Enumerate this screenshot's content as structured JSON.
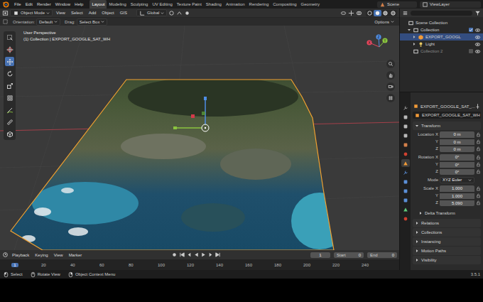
{
  "app": {
    "version": "3.5.1"
  },
  "menu": [
    "File",
    "Edit",
    "Render",
    "Window",
    "Help"
  ],
  "workspaces": [
    {
      "label": "Layout",
      "selected": true
    },
    {
      "label": "Modeling",
      "selected": false
    },
    {
      "label": "Sculpting",
      "selected": false
    },
    {
      "label": "UV Editing",
      "selected": false
    },
    {
      "label": "Texture Paint",
      "selected": false
    },
    {
      "label": "Shading",
      "selected": false
    },
    {
      "label": "Animation",
      "selected": false
    },
    {
      "label": "Rendering",
      "selected": false
    },
    {
      "label": "Compositing",
      "selected": false
    },
    {
      "label": "Geometry",
      "selected": false
    }
  ],
  "scene": {
    "name": "Scene"
  },
  "view_layer": {
    "name": "ViewLayer"
  },
  "viewport_header": {
    "mode": "Object Mode",
    "menus": [
      "View",
      "Select",
      "Add",
      "Object",
      "GIS"
    ],
    "orientation": "Global",
    "shading": [
      {
        "kind": "wireframe",
        "selected": false
      },
      {
        "kind": "solid",
        "selected": true
      },
      {
        "kind": "material",
        "selected": false
      },
      {
        "kind": "rendered",
        "selected": false
      }
    ]
  },
  "tool_header": {
    "orientation_label": "Orientation:",
    "orientation": "Default",
    "drag_label": "Drag:",
    "drag": "Select Box",
    "options": "Options"
  },
  "viewport": {
    "view_name": "User Perspective",
    "context": "(1) Collection | EXPORT_GOOGLE_SAT_WH",
    "terrain": {
      "selected": true
    }
  },
  "tools": [
    {
      "kind": "select",
      "selected": false
    },
    {
      "kind": "cursor",
      "selected": false
    },
    {
      "kind": "move",
      "selected": true
    },
    {
      "kind": "rotate",
      "selected": false
    },
    {
      "kind": "scale",
      "selected": false
    },
    {
      "kind": "transform",
      "selected": false
    },
    {
      "kind": "annotate",
      "selected": false
    },
    {
      "kind": "measure",
      "selected": false
    },
    {
      "kind": "add-cube",
      "selected": false
    }
  ],
  "navigation": {
    "axes": [
      {
        "label": "X",
        "color": "#e8475f"
      },
      {
        "label": "Y",
        "color": "#8bc53f"
      },
      {
        "label": "Z",
        "color": "#4f8ee6"
      }
    ],
    "buttons": [
      {
        "kind": "zoom"
      },
      {
        "kind": "pan"
      },
      {
        "kind": "camera"
      },
      {
        "kind": "ortho"
      }
    ]
  },
  "outliner": {
    "items": [
      {
        "label": "Scene Collection",
        "kind": "scene_collection",
        "selected": false,
        "children": [
          {
            "label": "Collection",
            "kind": "collection",
            "selected": false,
            "expanded": true,
            "checked": true,
            "visible": true,
            "children": [
              {
                "label": "EXPORT_GOOGL",
                "kind": "mesh",
                "selected": true,
                "expanded": false,
                "visible": true
              },
              {
                "label": "Light",
                "kind": "light",
                "selected": false,
                "expanded": false,
                "visible": true
              }
            ]
          },
          {
            "label": "Collection 2",
            "kind": "collection",
            "selected": false,
            "checked": false,
            "visible": true
          }
        ]
      }
    ]
  },
  "property_tabs": [
    {
      "kind": "tool",
      "selected": false,
      "color": "#a0a0a0"
    },
    {
      "kind": "render",
      "selected": false,
      "color": "#b9b9b9"
    },
    {
      "kind": "output",
      "selected": false,
      "color": "#b9b9b9"
    },
    {
      "kind": "view_layer",
      "selected": false,
      "color": "#b9b9b9"
    },
    {
      "kind": "scene",
      "selected": false,
      "color": "#d27f4a"
    },
    {
      "kind": "world",
      "selected": false,
      "color": "#d0412f"
    },
    {
      "kind": "object",
      "selected": true,
      "color": "#f29b38"
    },
    {
      "kind": "modifier",
      "selected": false,
      "color": "#5b8fd8"
    },
    {
      "kind": "particles",
      "selected": false,
      "color": "#5b8fd8"
    },
    {
      "kind": "physics",
      "selected": false,
      "color": "#5b8fd8"
    },
    {
      "kind": "constraint",
      "selected": false,
      "color": "#5b8fd8"
    },
    {
      "kind": "data",
      "selected": false,
      "color": "#5fc97a"
    },
    {
      "kind": "material",
      "selected": false,
      "color": "#d0412f"
    }
  ],
  "properties": {
    "header": "EXPORT_GOOGLE_SAT_...",
    "object_name": "EXPORT_GOOGLE_SAT_WH",
    "transform": {
      "title": "Transform",
      "expanded": true,
      "groups": [
        {
          "kind": "vector",
          "label": "Location",
          "values": [
            {
              "axis": "X",
              "value": "0 m"
            },
            {
              "axis": "Y",
              "value": "0 m"
            },
            {
              "axis": "Z",
              "value": "0 m"
            }
          ]
        },
        {
          "kind": "vector",
          "label": "Rotation",
          "values": [
            {
              "axis": "X",
              "value": "0°"
            },
            {
              "axis": "Y",
              "value": "0°"
            },
            {
              "axis": "Z",
              "value": "0°"
            }
          ]
        },
        {
          "kind": "select",
          "label": "Mode",
          "value": "XYZ Euler"
        },
        {
          "kind": "vector",
          "label": "Scale",
          "values": [
            {
              "axis": "X",
              "value": "1.000"
            },
            {
              "axis": "Y",
              "value": "1.000"
            },
            {
              "axis": "Z",
              "value": "5.090"
            }
          ]
        }
      ],
      "delta": {
        "title": "Delta Transform",
        "expanded": false
      }
    },
    "panels": [
      {
        "title": "Relations",
        "expanded": false
      },
      {
        "title": "Collections",
        "expanded": false
      },
      {
        "title": "Instancing",
        "expanded": false
      },
      {
        "title": "Motion Paths",
        "expanded": false
      },
      {
        "title": "Visibility",
        "expanded": false
      }
    ]
  },
  "timeline": {
    "menus": [
      "Playback",
      "Keying",
      "View",
      "Marker"
    ],
    "current_frame": "1",
    "start_label": "Start",
    "start": "0",
    "end_label": "End",
    "end": "0",
    "playhead": "1",
    "ruler": [
      "20",
      "40",
      "60",
      "80",
      "100",
      "120",
      "140",
      "160",
      "180",
      "200",
      "220",
      "240"
    ]
  },
  "status_bar": {
    "items": [
      {
        "label": "Select",
        "kind": "left"
      },
      {
        "label": "Rotate View",
        "kind": "middle"
      },
      {
        "label": "Object Context Menu",
        "kind": "right"
      }
    ]
  }
}
